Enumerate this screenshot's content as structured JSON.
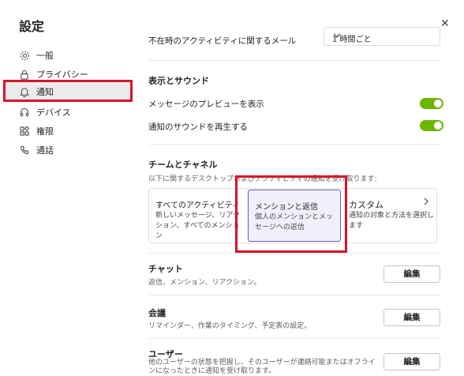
{
  "settings": {
    "title": "設定"
  },
  "sidebar": {
    "items": [
      {
        "label": "一般",
        "icon": "gear-icon"
      },
      {
        "label": "プライバシー",
        "icon": "lock-icon"
      },
      {
        "label": "通知",
        "icon": "bell-icon"
      },
      {
        "label": "デバイス",
        "icon": "headset-icon"
      },
      {
        "label": "権限",
        "icon": "apps-icon"
      },
      {
        "label": "通話",
        "icon": "phone-icon"
      }
    ],
    "active": "通知"
  },
  "main": {
    "missed_activity_label": "不在時のアクティビティに関するメール",
    "missed_activity_value": "1 時間ごと",
    "display_sound": {
      "heading": "表示とサウンド",
      "preview_label": "メッセージのプレビューを表示",
      "sound_label": "通知のサウンドを再生する"
    },
    "teams_channels": {
      "heading": "チームとチャネル",
      "desc": "以下に関するデスクトップおよびアクティビティの通知を受け取ります:",
      "cards": [
        {
          "title": "すべてのアクティビティ",
          "desc": "新しいメッセージ、リアクション、すべてのメンション"
        },
        {
          "title": "メンションと返信",
          "desc": "個人のメンションとメッセージへの返信"
        },
        {
          "title": "カスタム",
          "desc": "通知の対象と方法を選択します"
        }
      ]
    },
    "chat": {
      "heading": "チャット",
      "desc": "返信、メンション、リアクション。",
      "button": "編集"
    },
    "meetings": {
      "heading": "会議",
      "desc": "リマインダー、作業のタイミング、予定表の設定。",
      "button": "編集"
    },
    "users": {
      "heading": "ユーザー",
      "desc": "他のユーザーの状態を把握し、そのユーザーが連絡可能またはオフラインになったときに通知を受け取ります。",
      "button": "編集"
    }
  },
  "colors": {
    "toggle_on": "#6bb700",
    "highlight_red": "#d7142a",
    "selected_card_border": "#6264a7"
  }
}
